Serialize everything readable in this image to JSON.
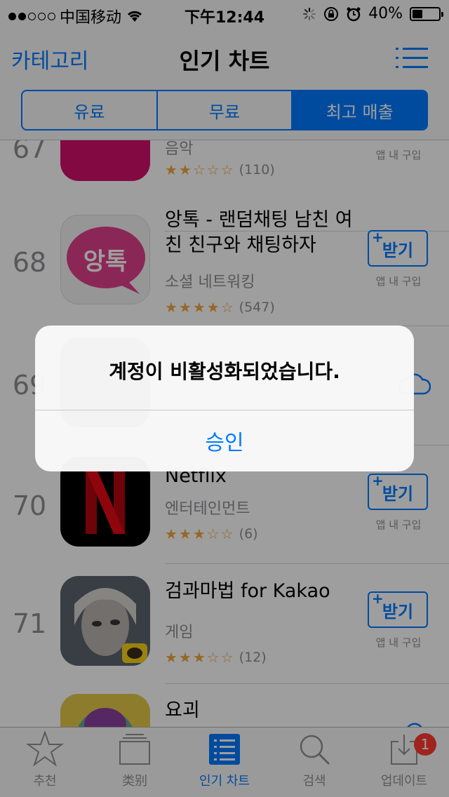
{
  "status_bar": {
    "carrier": "中国移动",
    "time": "下午12:44",
    "battery_text": "40%",
    "battery_level": 0.4
  },
  "nav": {
    "back_label": "카테고리",
    "title": "인기 차트",
    "segments": [
      "유료",
      "무료",
      "최고 매출"
    ],
    "active_segment": 2
  },
  "apps": [
    {
      "rank": "67",
      "name": "",
      "category": "음악",
      "stars": "★★☆☆☆",
      "reviews": "(110)",
      "iap": "앱 내 구입",
      "icon": "pink-app-icon",
      "icon_color": "#d4106c"
    },
    {
      "rank": "68",
      "name": "앙톡 - 랜덤채팅 남친 여친 친구와 채팅하자",
      "category": "소셜 네트워킹",
      "stars": "★★★★☆",
      "reviews": "(547)",
      "get_label": "받기",
      "iap": "앱 내 구입",
      "icon": "angtok-icon",
      "icon_text": "앙톡",
      "icon_color": "#e0408c"
    },
    {
      "rank": "69",
      "name": "",
      "category": "",
      "stars": "",
      "reviews": "",
      "icon": "hidden-app-icon"
    },
    {
      "rank": "70",
      "name": "Netflix",
      "category": "엔터테인먼트",
      "stars": "★★★☆☆",
      "reviews": "(6)",
      "get_label": "받기",
      "iap": "앱 내 구입",
      "icon": "netflix-icon",
      "icon_color": "#b20710"
    },
    {
      "rank": "71",
      "name": "검과마법 for Kakao",
      "category": "게임",
      "stars": "★★★☆☆",
      "reviews": "(12)",
      "get_label": "받기",
      "iap": "앱 내 구입",
      "icon": "game-character-icon"
    },
    {
      "rank": "72",
      "name": "요괴",
      "category": "",
      "stars": "",
      "reviews": "",
      "icon": "yokai-icon"
    }
  ],
  "tabs": [
    {
      "label": "추천",
      "icon": "star-icon"
    },
    {
      "label": "类别",
      "icon": "categories-icon"
    },
    {
      "label": "인기 차트",
      "icon": "top-charts-icon",
      "active": true
    },
    {
      "label": "검색",
      "icon": "search-icon"
    },
    {
      "label": "업데이트",
      "icon": "updates-icon",
      "badge": "1"
    }
  ],
  "alert": {
    "message": "계정이 비활성화되었습니다.",
    "button": "승인"
  }
}
